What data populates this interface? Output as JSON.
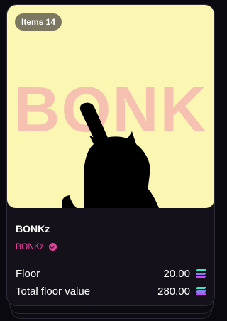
{
  "nft_card": {
    "items_badge": "Items 14",
    "art_text": "BONK",
    "collection_name": "BONKz",
    "creator_name": "BONKz",
    "stats": [
      {
        "label": "Floor",
        "value": "20.00",
        "currency_icon": "solana-icon"
      },
      {
        "label": "Total floor value",
        "value": "280.00",
        "currency_icon": "solana-icon"
      }
    ],
    "colors": {
      "background": "#0b0910",
      "card": "#14111a",
      "art_background": "#fcf6b3",
      "art_text": "#f6c1b0",
      "accent": "#e0449a"
    }
  }
}
